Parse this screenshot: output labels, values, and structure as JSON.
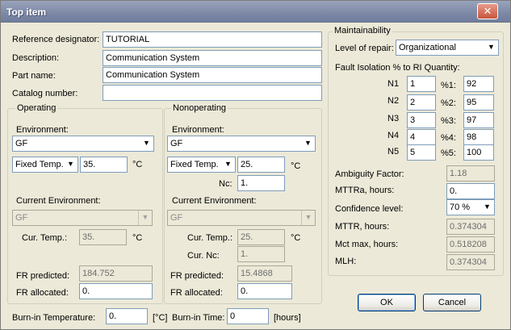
{
  "window": {
    "title": "Top item",
    "close_glyph": "✕"
  },
  "top": {
    "reference_designator": {
      "label": "Reference designator:",
      "value": "TUTORIAL"
    },
    "description": {
      "label": "Description:",
      "value": "Communication System"
    },
    "part_name": {
      "label": "Part name:",
      "value": "Communication System"
    },
    "catalog_number": {
      "label": "Catalog number:",
      "value": ""
    }
  },
  "operating": {
    "title": "Operating",
    "environment_label": "Environment:",
    "environment": "GF",
    "temp_mode": "Fixed Temp.",
    "temp_value": "35.",
    "temp_unit": "°C",
    "current_environment_label": "Current Environment:",
    "current_environment": "GF",
    "cur_temp_label": "Cur. Temp.:",
    "cur_temp": "35.",
    "cur_temp_unit": "°C",
    "fr_predicted_label": "FR predicted:",
    "fr_predicted": "184.752",
    "fr_allocated_label": "FR allocated:",
    "fr_allocated": "0."
  },
  "nonoperating": {
    "title": "Nonoperating",
    "environment_label": "Environment:",
    "environment": "GF",
    "temp_mode": "Fixed Temp.",
    "temp_value": "25.",
    "temp_unit": "°C",
    "nc_label": "Nc:",
    "nc_value": "1.",
    "current_environment_label": "Current Environment:",
    "current_environment": "GF",
    "cur_temp_label": "Cur. Temp.:",
    "cur_temp": "25.",
    "cur_temp_unit": "°C",
    "cur_nc_label": "Cur. Nc:",
    "cur_nc": "1.",
    "fr_predicted_label": "FR predicted:",
    "fr_predicted": "15.4868",
    "fr_allocated_label": "FR allocated:",
    "fr_allocated": "0."
  },
  "maintainability": {
    "title": "Maintainability",
    "level_label": "Level of repair:",
    "level": "Organizational",
    "fault_label": "Fault Isolation % to RI Quantity:",
    "rows": [
      {
        "n_label": "N1",
        "n": "1",
        "p_label": "%1:",
        "p": "92"
      },
      {
        "n_label": "N2",
        "n": "2",
        "p_label": "%2:",
        "p": "95"
      },
      {
        "n_label": "N3",
        "n": "3",
        "p_label": "%3:",
        "p": "97"
      },
      {
        "n_label": "N4",
        "n": "4",
        "p_label": "%4:",
        "p": "98"
      },
      {
        "n_label": "N5",
        "n": "5",
        "p_label": "%5:",
        "p": "100"
      }
    ],
    "ambiguity_label": "Ambiguity Factor:",
    "ambiguity": "1.18",
    "mttra_label": "MTTRa, hours:",
    "mttra": "0.",
    "confidence_label": "Confidence level:",
    "confidence": "70 %",
    "mttr_label": "MTTR, hours:",
    "mttr": "0.374304",
    "mct_label": "Mct max, hours:",
    "mct": "0.518208",
    "mlh_label": "MLH:",
    "mlh": "0.374304"
  },
  "bottom": {
    "burnin_temp_label": "Burn-in Temperature:",
    "burnin_temp": "0.",
    "burnin_temp_unit": "[°C]",
    "burnin_time_label": "Burn-in Time:",
    "burnin_time": "0",
    "burnin_time_unit": "[hours]"
  },
  "buttons": {
    "ok": "OK",
    "cancel": "Cancel"
  },
  "icons": {
    "dropdown_arrow": "▼"
  }
}
